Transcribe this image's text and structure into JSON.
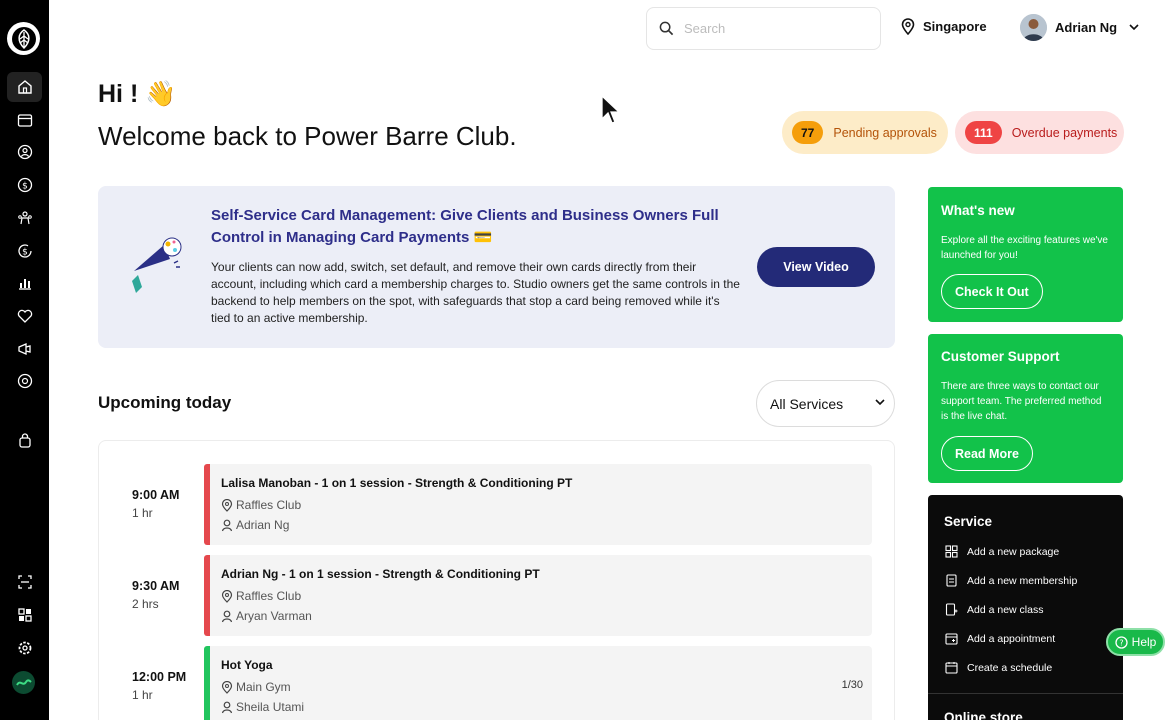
{
  "sidebar": {
    "items": [
      {
        "name": "home"
      },
      {
        "name": "calendar"
      },
      {
        "name": "clients"
      },
      {
        "name": "sales"
      },
      {
        "name": "staff"
      },
      {
        "name": "payments"
      },
      {
        "name": "reports"
      },
      {
        "name": "loyalty"
      },
      {
        "name": "marketing"
      },
      {
        "name": "integrations"
      },
      {
        "name": "bag"
      }
    ],
    "bottom_items": [
      {
        "name": "scan"
      },
      {
        "name": "apps"
      },
      {
        "name": "settings"
      }
    ]
  },
  "topbar": {
    "search_placeholder": "Search",
    "location": "Singapore",
    "user_name": "Adrian Ng"
  },
  "greeting": {
    "hi": "Hi ! 👋",
    "welcome": "Welcome back to Power Barre Club."
  },
  "stats": {
    "pending_count": "77",
    "pending_label": "Pending approvals",
    "overdue_count": "111",
    "overdue_label": "Overdue payments"
  },
  "announcement": {
    "title": "Self-Service Card Management: Give Clients and Business Owners Full Control in Managing Card Payments 💳",
    "body": "Your clients can now add, switch, set default, and remove their own cards directly from their account, including which card a membership charges to. Studio owners get the same controls in the backend to help members on the spot, with safeguards that stop a card being removed while it's tied to an active membership.",
    "button": "View Video"
  },
  "upcoming": {
    "title": "Upcoming today",
    "filter": "All Services",
    "events": [
      {
        "time": "9:00 AM",
        "duration": "1 hr",
        "title": "Lalisa Manoban - 1 on 1 session - Strength & Conditioning PT",
        "location": "Raffles Club",
        "staff": "Adrian Ng",
        "capacity": "",
        "color": "#e5484d"
      },
      {
        "time": "9:30 AM",
        "duration": "2 hrs",
        "title": "Adrian Ng - 1 on 1 session - Strength & Conditioning PT",
        "location": "Raffles Club",
        "staff": "Aryan Varman",
        "capacity": "",
        "color": "#e5484d"
      },
      {
        "time": "12:00 PM",
        "duration": "1 hr",
        "title": "Hot Yoga",
        "location": "Main Gym",
        "staff": "Sheila Utami",
        "capacity": "1/30",
        "color": "#22c55e"
      }
    ]
  },
  "whats_new": {
    "title": "What's new",
    "desc": "Explore all the exciting features we've launched for you!",
    "button": "Check It Out"
  },
  "support": {
    "title": "Customer Support",
    "desc": "There are three ways to contact our support team. The preferred method is the live chat.",
    "button": "Read More"
  },
  "service": {
    "title": "Service",
    "items": [
      {
        "label": "Add a new package",
        "icon": "package-icon"
      },
      {
        "label": "Add a new membership",
        "icon": "membership-icon"
      },
      {
        "label": "Add a new class",
        "icon": "class-icon"
      },
      {
        "label": "Add a appointment",
        "icon": "appointment-icon"
      },
      {
        "label": "Create a schedule",
        "icon": "schedule-icon"
      }
    ],
    "next_section": "Online store"
  },
  "help": {
    "label": "Help"
  }
}
